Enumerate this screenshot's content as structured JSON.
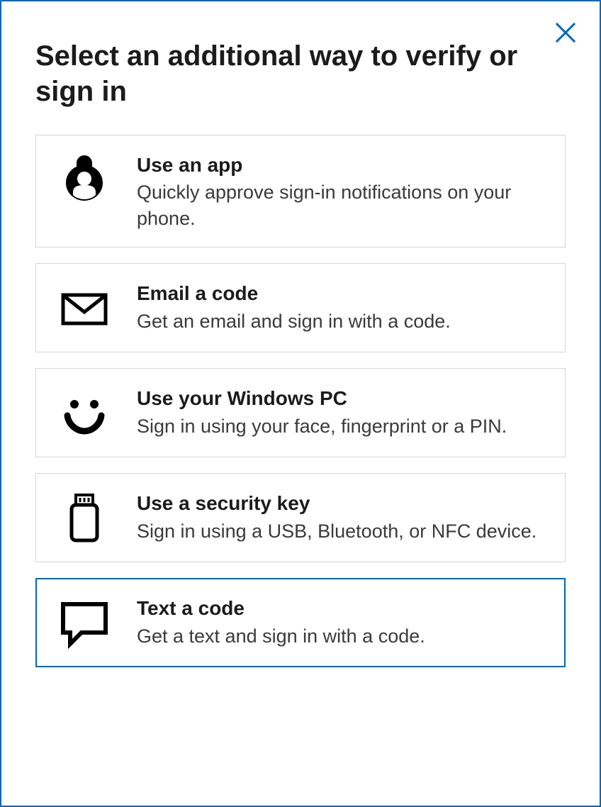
{
  "dialog": {
    "title": "Select an additional way to verify or sign in"
  },
  "options": [
    {
      "icon": "authenticator-app-icon",
      "title": "Use an app",
      "desc": "Quickly approve sign-in notifications on your phone.",
      "selected": false
    },
    {
      "icon": "email-icon",
      "title": "Email a code",
      "desc": "Get an email and sign in with a code.",
      "selected": false
    },
    {
      "icon": "windows-hello-icon",
      "title": "Use your Windows PC",
      "desc": "Sign in using your face, fingerprint or a PIN.",
      "selected": false
    },
    {
      "icon": "security-key-icon",
      "title": "Use a security key",
      "desc": "Sign in using a USB, Bluetooth, or NFC device.",
      "selected": false
    },
    {
      "icon": "text-message-icon",
      "title": "Text a code",
      "desc": "Get a text and sign in with a code.",
      "selected": true
    }
  ]
}
